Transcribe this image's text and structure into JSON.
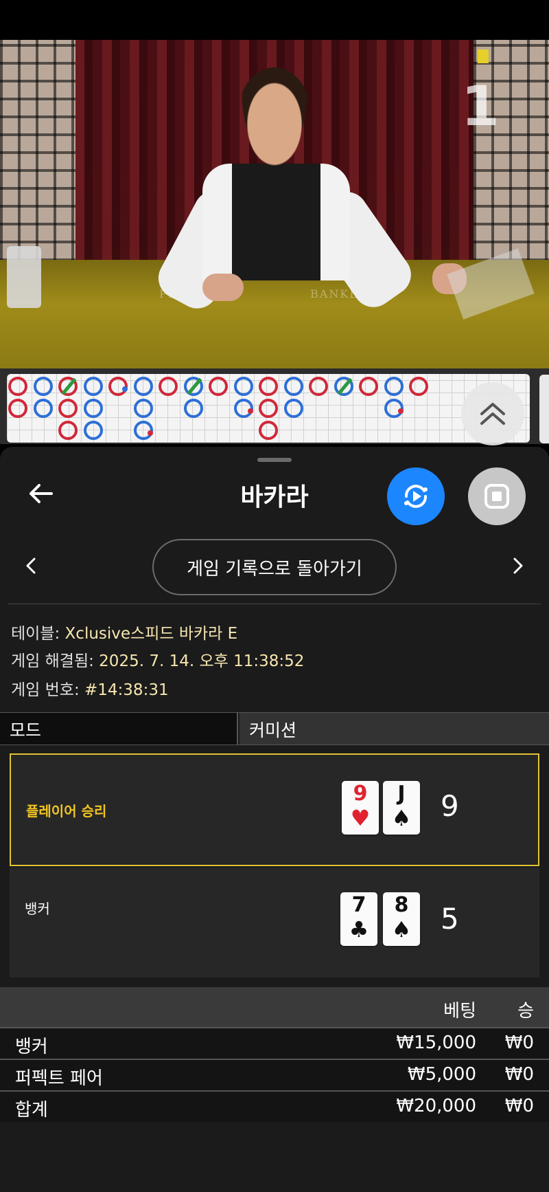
{
  "video": {
    "round_number": "1",
    "felt_player": "PLAYER",
    "felt_banker": "BANKER"
  },
  "road": {
    "beads": [
      {
        "col": 0,
        "row": 0,
        "c": "b"
      },
      {
        "col": 1,
        "row": 0,
        "c": "p"
      },
      {
        "col": 2,
        "row": 0,
        "c": "b",
        "tie": true
      },
      {
        "col": 3,
        "row": 0,
        "c": "p"
      },
      {
        "col": 4,
        "row": 0,
        "c": "b",
        "dot": "p"
      },
      {
        "col": 5,
        "row": 0,
        "c": "p"
      },
      {
        "col": 6,
        "row": 0,
        "c": "b"
      },
      {
        "col": 7,
        "row": 0,
        "c": "p",
        "tie": true
      },
      {
        "col": 8,
        "row": 0,
        "c": "b"
      },
      {
        "col": 9,
        "row": 0,
        "c": "p"
      },
      {
        "col": 10,
        "row": 0,
        "c": "b"
      },
      {
        "col": 11,
        "row": 0,
        "c": "p"
      },
      {
        "col": 12,
        "row": 0,
        "c": "b"
      },
      {
        "col": 13,
        "row": 0,
        "c": "p",
        "tie": true
      },
      {
        "col": 14,
        "row": 0,
        "c": "b"
      },
      {
        "col": 15,
        "row": 0,
        "c": "p"
      },
      {
        "col": 16,
        "row": 0,
        "c": "b"
      },
      {
        "col": 0,
        "row": 1,
        "c": "b"
      },
      {
        "col": 1,
        "row": 1,
        "c": "p"
      },
      {
        "col": 2,
        "row": 1,
        "c": "b"
      },
      {
        "col": 3,
        "row": 1,
        "c": "p"
      },
      {
        "col": 5,
        "row": 1,
        "c": "p"
      },
      {
        "col": 7,
        "row": 1,
        "c": "p"
      },
      {
        "col": 9,
        "row": 1,
        "c": "p",
        "dot": "b"
      },
      {
        "col": 10,
        "row": 1,
        "c": "b"
      },
      {
        "col": 11,
        "row": 1,
        "c": "p"
      },
      {
        "col": 15,
        "row": 1,
        "c": "p",
        "dot": "b"
      },
      {
        "col": 2,
        "row": 2,
        "c": "b"
      },
      {
        "col": 3,
        "row": 2,
        "c": "p"
      },
      {
        "col": 5,
        "row": 2,
        "c": "p",
        "dot": "b"
      },
      {
        "col": 10,
        "row": 2,
        "c": "b"
      }
    ]
  },
  "header": {
    "title": "바카라"
  },
  "nav": {
    "history_button": "게임 기록으로 돌아가기"
  },
  "info": {
    "table_label": "테이블: ",
    "table_value": "Xclusive스피드 바카라 E",
    "resolved_label": "게임 해결됨: ",
    "resolved_value": "2025. 7. 14. 오후 11:38:52",
    "number_label": "게임 번호: ",
    "number_value": "#14:38:31"
  },
  "mode": {
    "label": "모드",
    "value": "커미션"
  },
  "results": {
    "player": {
      "label": "플레이어 승리",
      "cards": [
        {
          "rank": "9",
          "suit": "♥",
          "color": "red"
        },
        {
          "rank": "J",
          "suit": "♠",
          "color": "black"
        }
      ],
      "score": "9"
    },
    "banker": {
      "label": "뱅커",
      "cards": [
        {
          "rank": "7",
          "suit": "♣",
          "color": "black"
        },
        {
          "rank": "8",
          "suit": "♠",
          "color": "black"
        }
      ],
      "score": "5"
    }
  },
  "bets": {
    "header_bet": "베팅",
    "header_win": "승",
    "rows": [
      {
        "name": "뱅커",
        "bet": "₩15,000",
        "win": "₩0"
      },
      {
        "name": "퍼펙트 페어",
        "bet": "₩5,000",
        "win": "₩0"
      },
      {
        "name": "합계",
        "bet": "₩20,000",
        "win": "₩0"
      }
    ]
  },
  "colors": {
    "accent_blue": "#1c86ff",
    "win_gold": "#f2c521",
    "banker_red": "#d0283a",
    "player_blue": "#2d6fd6",
    "tie_green": "#2b9a3e"
  }
}
